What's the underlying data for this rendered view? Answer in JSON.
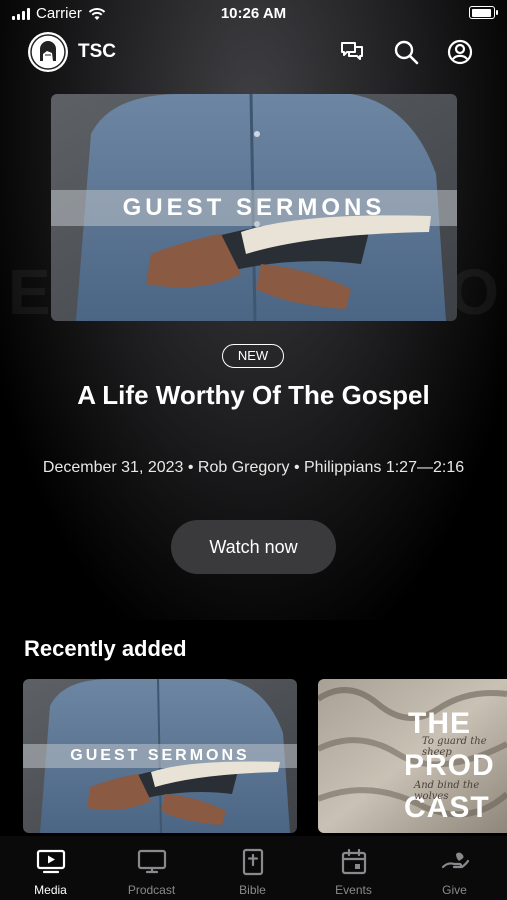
{
  "status_bar": {
    "carrier": "Carrier",
    "time": "10:26 AM"
  },
  "header": {
    "app_name": "TSC",
    "icons": [
      "chat-bubbles-icon",
      "search-icon",
      "profile-icon"
    ]
  },
  "hero": {
    "image_text": "GUEST SERMONS",
    "badge": "NEW",
    "title": "A Life Worthy Of The Gospel",
    "meta": "December 31, 2023 • Rob Gregory • Philippians 1:27—2:16",
    "cta_label": "Watch now"
  },
  "recently_added": {
    "title": "Recently added",
    "cards": [
      {
        "image_text": "GUEST SERMONS"
      },
      {
        "image_lines": [
          "THE",
          "PROD",
          "CAST"
        ],
        "script_lines": [
          "To guard the sheep",
          "And bind the wolves"
        ]
      }
    ]
  },
  "tabs": [
    {
      "label": "Media",
      "icon": "play-screen-icon",
      "active": true
    },
    {
      "label": "Prodcast",
      "icon": "monitor-icon",
      "active": false
    },
    {
      "label": "Bible",
      "icon": "bible-icon",
      "active": false
    },
    {
      "label": "Events",
      "icon": "calendar-icon",
      "active": false
    },
    {
      "label": "Give",
      "icon": "give-hand-icon",
      "active": false
    }
  ],
  "colors": {
    "background": "#000000",
    "button": "#3a3a3c",
    "tab_inactive": "#8a8a8e"
  }
}
